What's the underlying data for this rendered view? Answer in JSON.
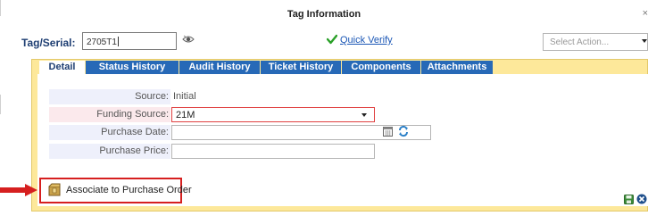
{
  "dialog": {
    "title": "Tag Information"
  },
  "tag_serial": {
    "label": "Tag/Serial:",
    "value": "2705T1"
  },
  "quick_verify": {
    "label": "Quick Verify"
  },
  "select_action": {
    "placeholder": "Select Action..."
  },
  "tabs": [
    {
      "label": "Detail",
      "active": true
    },
    {
      "label": "Status History",
      "active": false
    },
    {
      "label": "Audit History",
      "active": false
    },
    {
      "label": "Ticket History",
      "active": false
    },
    {
      "label": "Components",
      "active": false
    },
    {
      "label": "Attachments",
      "active": false
    }
  ],
  "detail": {
    "source": {
      "label": "Source:",
      "value": "Initial"
    },
    "funding_source": {
      "label": "Funding Source:",
      "value": "21M"
    },
    "purchase_date": {
      "label": "Purchase Date:",
      "value": ""
    },
    "purchase_price": {
      "label": "Purchase Price:",
      "value": ""
    }
  },
  "associate": {
    "label": "Associate to Purchase Order"
  },
  "colors": {
    "tab_blue": "#2769b7",
    "panel_yellow": "#fde89a",
    "highlight_red": "#d61f1f",
    "link_blue": "#1a56b5"
  },
  "icons": [
    "eye-icon",
    "check-icon",
    "calendar-icon",
    "refresh-icon",
    "package-icon",
    "save-icon",
    "cancel-icon",
    "red-arrow-icon"
  ]
}
